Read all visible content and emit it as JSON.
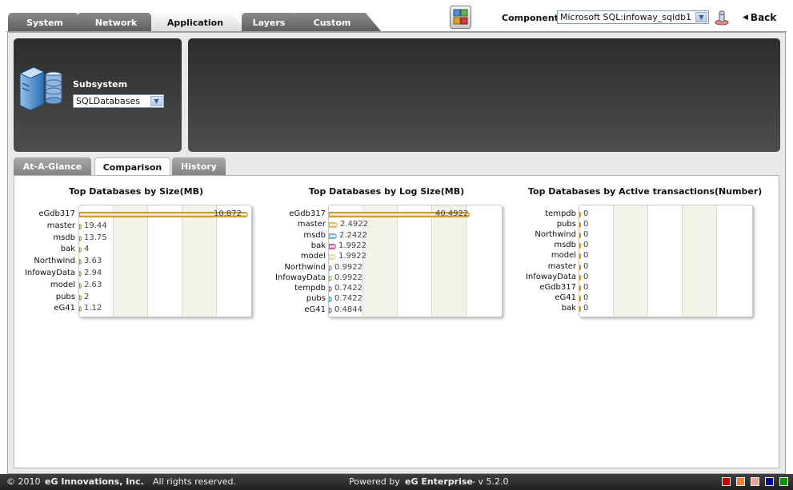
{
  "nav": {
    "tabs": [
      {
        "label": "System",
        "active": false
      },
      {
        "label": "Network",
        "active": false
      },
      {
        "label": "Application",
        "active": true
      },
      {
        "label": "Layers",
        "active": false
      },
      {
        "label": "Custom",
        "active": false
      }
    ],
    "component_label": "Component",
    "component_value": "Microsoft SQL:infoway_sqldb1",
    "back_label": "Back"
  },
  "subsystem": {
    "label": "Subsystem",
    "value": "SQLDatabases"
  },
  "view_tabs": [
    {
      "label": "At-A-Glance",
      "active": false
    },
    {
      "label": "Comparison",
      "active": true
    },
    {
      "label": "History",
      "active": false
    }
  ],
  "chart_data": [
    {
      "type": "bar",
      "title": "Top Databases by Size(MB)",
      "categories": [
        "eGdb317",
        "master",
        "msdb",
        "bak",
        "Northwind",
        "InfowayData",
        "model",
        "pubs",
        "eG41"
      ],
      "values": [
        10.872,
        19.44,
        13.75,
        4,
        3.63,
        2.94,
        2.63,
        2,
        1.12
      ],
      "labels": [
        "10.872",
        "19.44",
        "13.75",
        "4",
        "3.63",
        "2.94",
        "2.63",
        "2",
        "1.12"
      ],
      "colors": [
        "#c9961d",
        "#c9961d",
        "#c9961d",
        "#c9961d",
        "#c9961d",
        "#c9961d",
        "#c9961d",
        "#c9961d",
        "#c9961d"
      ]
    },
    {
      "type": "bar",
      "title": "Top Databases by Log Size(MB)",
      "categories": [
        "eGdb317",
        "master",
        "msdb",
        "bak",
        "model",
        "Northwind",
        "InfowayData",
        "tempdb",
        "pubs",
        "eG41"
      ],
      "values": [
        40.4922,
        2.4922,
        2.2422,
        1.9922,
        1.9922,
        0.9922,
        0.9922,
        0.7422,
        0.7422,
        0.4844
      ],
      "labels": [
        "40.4922",
        "2.4922",
        "2.2422",
        "1.9922",
        "1.9922",
        "0.9922",
        "0.9922",
        "0.7422",
        "0.7422",
        "0.4844"
      ],
      "colors": [
        "#c9961d",
        "#e8b84a",
        "#6aa8d8",
        "#d04fa0",
        "#e7d98c",
        "#9a9a9a",
        "#8cc06a",
        "#8a7ec8",
        "#2fb3b0",
        "#a070b0"
      ]
    },
    {
      "type": "bar",
      "title": "Top Databases by Active transactions(Number)",
      "categories": [
        "tempdb",
        "pubs",
        "Northwind",
        "msdb",
        "model",
        "master",
        "InfowayData",
        "eGdb317",
        "eG41",
        "bak"
      ],
      "values": [
        0,
        0,
        0,
        0,
        0,
        0,
        0,
        0,
        0,
        0
      ],
      "labels": [
        "0",
        "0",
        "0",
        "0",
        "0",
        "0",
        "0",
        "0",
        "0",
        "0"
      ],
      "colors": [
        "#c9961d",
        "#c9961d",
        "#c9961d",
        "#c9961d",
        "#c9961d",
        "#c9961d",
        "#c9961d",
        "#c9961d",
        "#c9961d",
        "#c9961d"
      ]
    }
  ],
  "footer": {
    "copyright_prefix": "© 2010",
    "company": "eG Innovations, Inc.",
    "rights": "All rights reserved.",
    "powered_prefix": "Powered by",
    "product": "eG Enterprise",
    "version": "- v 5.2.0",
    "legend_colors": [
      "#cc0000",
      "#f0803a",
      "#f4a0a0",
      "#000099",
      "#009900"
    ]
  }
}
